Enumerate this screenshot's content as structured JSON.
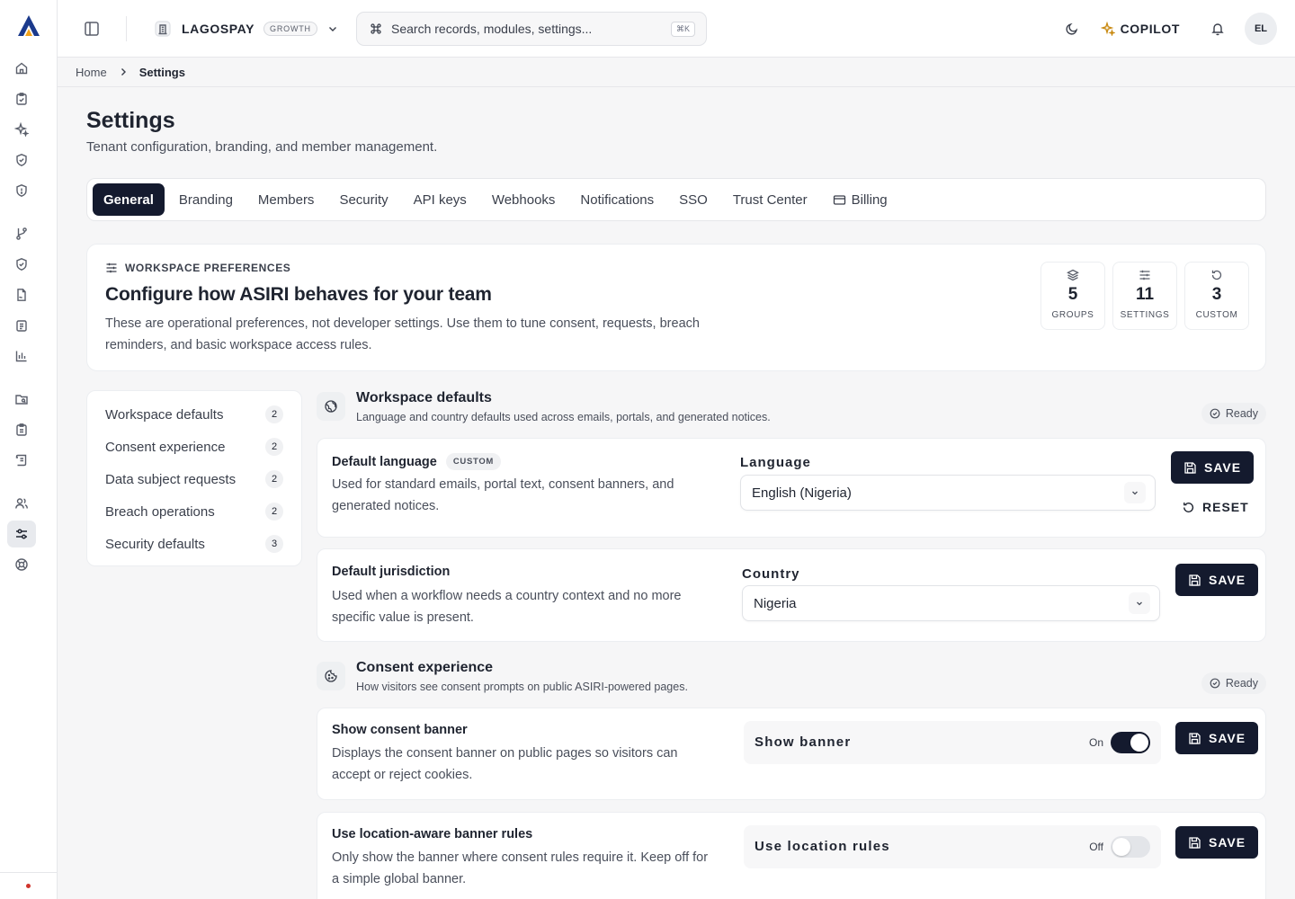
{
  "topbar": {
    "workspace_name": "LAGOSPAY",
    "workspace_plan": "GROWTH",
    "search_placeholder": "Search records, modules, settings...",
    "search_shortcut": "⌘K",
    "copilot_label": "COPILOT",
    "avatar_initials": "EL"
  },
  "breadcrumb": {
    "home": "Home",
    "current": "Settings"
  },
  "page": {
    "title": "Settings",
    "subtitle": "Tenant configuration, branding, and member management."
  },
  "tabs": [
    {
      "label": "General",
      "active": true
    },
    {
      "label": "Branding"
    },
    {
      "label": "Members"
    },
    {
      "label": "Security"
    },
    {
      "label": "API keys"
    },
    {
      "label": "Webhooks"
    },
    {
      "label": "Notifications"
    },
    {
      "label": "SSO"
    },
    {
      "label": "Trust Center"
    },
    {
      "label": "Billing",
      "icon": "credit-card-icon"
    }
  ],
  "hero": {
    "eyebrow": "WORKSPACE PREFERENCES",
    "title": "Configure how ASIRI behaves for your team",
    "description": "These are operational preferences, not developer settings. Use them to tune consent, requests, breach reminders, and basic workspace access rules.",
    "stats": [
      {
        "value": "5",
        "label": "GROUPS",
        "icon": "layers-icon"
      },
      {
        "value": "11",
        "label": "SETTINGS",
        "icon": "sliders-icon"
      },
      {
        "value": "3",
        "label": "CUSTOM",
        "icon": "rotate-icon"
      }
    ]
  },
  "sidenav": [
    {
      "label": "Workspace defaults",
      "count": "2"
    },
    {
      "label": "Consent experience",
      "count": "2"
    },
    {
      "label": "Data subject requests",
      "count": "2"
    },
    {
      "label": "Breach operations",
      "count": "2"
    },
    {
      "label": "Security defaults",
      "count": "3"
    }
  ],
  "groups": {
    "workspace": {
      "title": "Workspace defaults",
      "subtitle": "Language and country defaults used across emails, portals, and generated notices.",
      "status": "Ready"
    },
    "consent": {
      "title": "Consent experience",
      "subtitle": "How visitors see consent prompts on public ASIRI-powered pages.",
      "status": "Ready"
    }
  },
  "settings": {
    "language": {
      "title": "Default language",
      "badge": "CUSTOM",
      "description": "Used for standard emails, portal text, consent banners, and generated notices.",
      "field_label": "Language",
      "value": "English (Nigeria)",
      "save": "SAVE",
      "reset": "RESET"
    },
    "jurisdiction": {
      "title": "Default jurisdiction",
      "description": "Used when a workflow needs a country context and no more specific value is present.",
      "field_label": "Country",
      "value": "Nigeria",
      "save": "SAVE"
    },
    "banner": {
      "title": "Show consent banner",
      "description": "Displays the consent banner on public pages so visitors can accept or reject cookies.",
      "toggle_label": "Show banner",
      "state": "On",
      "save": "SAVE"
    },
    "location": {
      "title": "Use location-aware banner rules",
      "description": "Only show the banner where consent rules require it. Keep off for a simple global banner.",
      "toggle_label": "Use location rules",
      "state": "Off",
      "save": "SAVE"
    }
  },
  "colors": {
    "primary": "#141a2e",
    "alert_dot": "#d0342c"
  }
}
